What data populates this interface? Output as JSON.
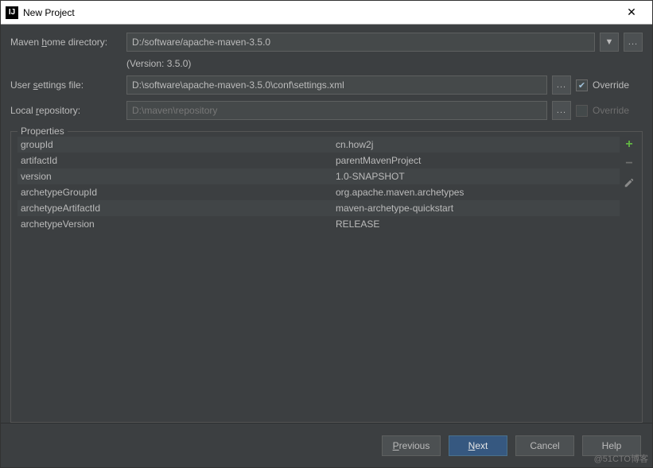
{
  "window": {
    "title": "New Project"
  },
  "mavenHome": {
    "label_pre": "Maven ",
    "label_u": "h",
    "label_post": "ome directory:",
    "value": "D:/software/apache-maven-3.5.0",
    "version_text": "(Version: 3.5.0)"
  },
  "userSettings": {
    "label_pre": "User ",
    "label_u": "s",
    "label_post": "ettings file:",
    "value": "D:\\software\\apache-maven-3.5.0\\conf\\settings.xml",
    "override_label": "Override",
    "override_checked": true
  },
  "localRepo": {
    "label_pre": "Local ",
    "label_u": "r",
    "label_post": "epository:",
    "value": "D:\\maven\\repository",
    "override_label": "Override",
    "override_checked": false
  },
  "properties": {
    "legend": "Properties",
    "rows": [
      {
        "k": "groupId",
        "v": "cn.how2j"
      },
      {
        "k": "artifactId",
        "v": "parentMavenProject"
      },
      {
        "k": "version",
        "v": "1.0-SNAPSHOT"
      },
      {
        "k": "archetypeGroupId",
        "v": "org.apache.maven.archetypes"
      },
      {
        "k": "archetypeArtifactId",
        "v": "maven-archetype-quickstart"
      },
      {
        "k": "archetypeVersion",
        "v": "RELEASE"
      }
    ]
  },
  "buttons": {
    "previous_u": "P",
    "previous_post": "revious",
    "next_u": "N",
    "next_post": "ext",
    "cancel": "Cancel",
    "help": "Help"
  },
  "watermark": "@51CTO博客"
}
